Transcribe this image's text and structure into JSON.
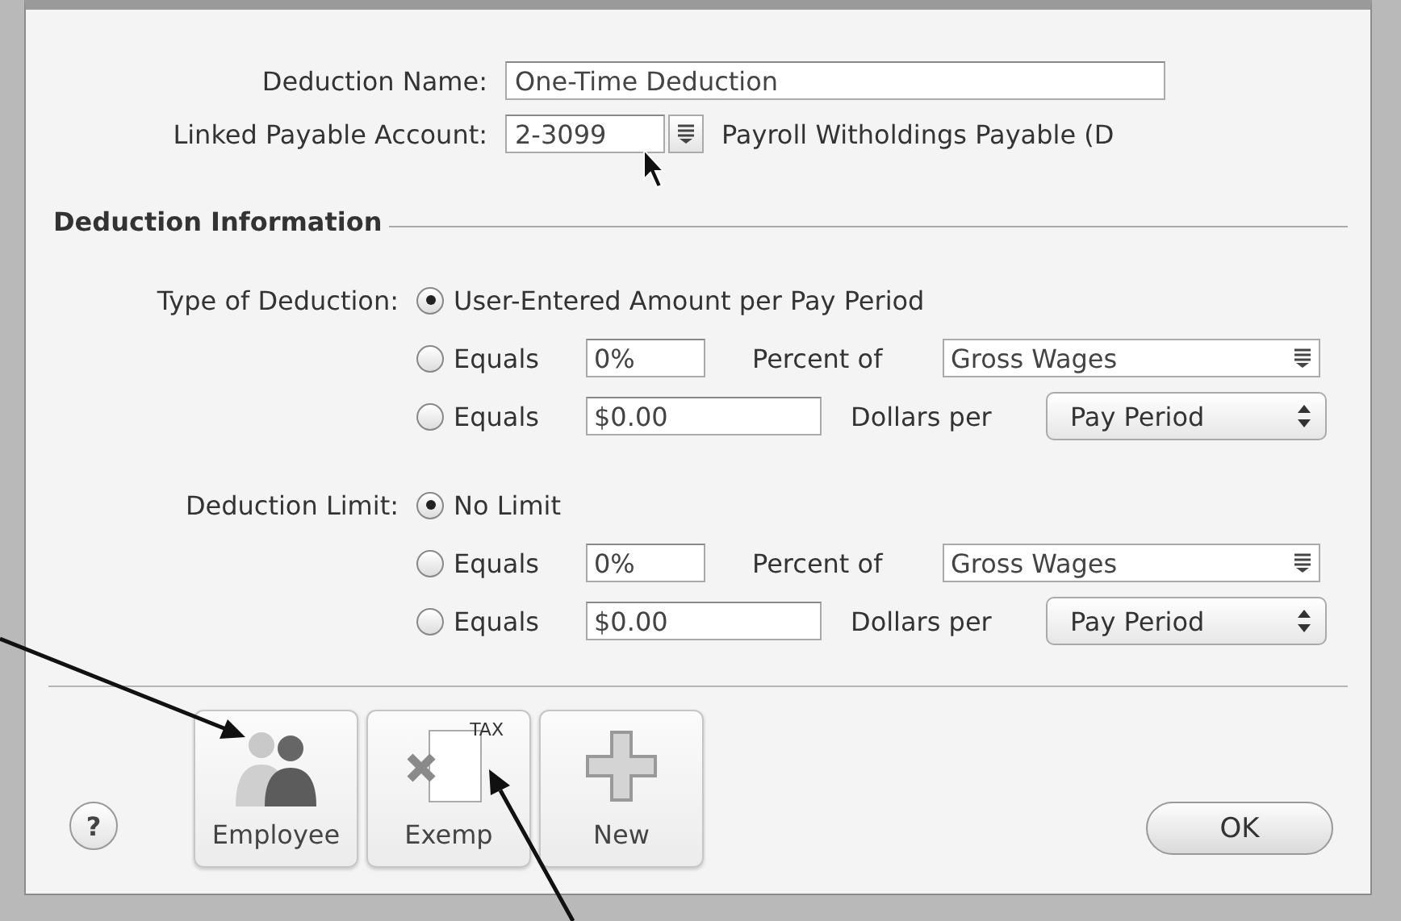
{
  "deduction_name": {
    "label": "Deduction Name:",
    "value": "One-Time Deduction"
  },
  "linked_account": {
    "label": "Linked Payable Account:",
    "value": "2-3099",
    "account_name": "Payroll Witholdings Payable (D"
  },
  "section": {
    "title": "Deduction Information"
  },
  "groups": [
    {
      "label": "Type of Deduction:",
      "options": [
        {
          "kind": "text",
          "label": "User-Entered Amount per Pay Period",
          "selected": true
        },
        {
          "kind": "percent",
          "label": "Equals",
          "value": "0%",
          "basis_label": "Percent of",
          "basis": "Gross Wages",
          "selected": false
        },
        {
          "kind": "dollars",
          "label": "Equals",
          "value": "$0.00",
          "per_label": "Dollars per",
          "per": "Pay Period",
          "selected": false
        }
      ]
    },
    {
      "label": "Deduction Limit:",
      "options": [
        {
          "kind": "text",
          "label": "No Limit",
          "selected": true
        },
        {
          "kind": "percent",
          "label": "Equals",
          "value": "0%",
          "basis_label": "Percent of",
          "basis": "Gross Wages",
          "selected": false
        },
        {
          "kind": "dollars",
          "label": "Equals",
          "value": "$0.00",
          "per_label": "Dollars per",
          "per": "Pay Period",
          "selected": false
        }
      ]
    }
  ],
  "toolbar_buttons": [
    {
      "kind": "employee",
      "label": "Employee"
    },
    {
      "kind": "tax",
      "label": "Exemp",
      "icon_text": "TAX"
    },
    {
      "kind": "new",
      "label": "New"
    }
  ],
  "help_button": {
    "label": "?"
  },
  "ok_button": {
    "label": "OK"
  }
}
